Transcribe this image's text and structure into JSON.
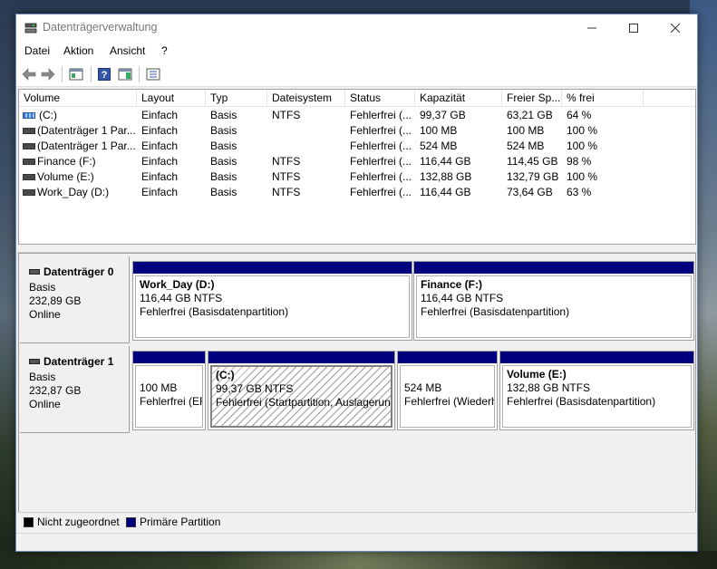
{
  "window": {
    "title": "Datenträgerverwaltung"
  },
  "menu": [
    "Datei",
    "Aktion",
    "Ansicht",
    "?"
  ],
  "list": {
    "columns": [
      "Volume",
      "Layout",
      "Typ",
      "Dateisystem",
      "Status",
      "Kapazität",
      "Freier Sp...",
      "% frei"
    ],
    "rows": [
      {
        "volume": "(C:)",
        "layout": "Einfach",
        "type": "Basis",
        "fs": "NTFS",
        "status": "Fehlerfrei (...",
        "capacity": "99,37 GB",
        "free": "63,21 GB",
        "pct": "64 %"
      },
      {
        "volume": "(Datenträger 1 Par...",
        "layout": "Einfach",
        "type": "Basis",
        "fs": "",
        "status": "Fehlerfrei (...",
        "capacity": "100 MB",
        "free": "100 MB",
        "pct": "100 %"
      },
      {
        "volume": "(Datenträger 1 Par...",
        "layout": "Einfach",
        "type": "Basis",
        "fs": "",
        "status": "Fehlerfrei (...",
        "capacity": "524 MB",
        "free": "524 MB",
        "pct": "100 %"
      },
      {
        "volume": "Finance (F:)",
        "layout": "Einfach",
        "type": "Basis",
        "fs": "NTFS",
        "status": "Fehlerfrei (...",
        "capacity": "116,44 GB",
        "free": "114,45 GB",
        "pct": "98 %"
      },
      {
        "volume": "Volume (E:)",
        "layout": "Einfach",
        "type": "Basis",
        "fs": "NTFS",
        "status": "Fehlerfrei (...",
        "capacity": "132,88 GB",
        "free": "132,79 GB",
        "pct": "100 %"
      },
      {
        "volume": "Work_Day (D:)",
        "layout": "Einfach",
        "type": "Basis",
        "fs": "NTFS",
        "status": "Fehlerfrei (...",
        "capacity": "116,44 GB",
        "free": "73,64 GB",
        "pct": "63 %"
      }
    ]
  },
  "disks": [
    {
      "name": "Datenträger 0",
      "type": "Basis",
      "size": "232,89 GB",
      "state": "Online",
      "partitions": [
        {
          "name": "Work_Day  (D:)",
          "size": "116,44 GB NTFS",
          "status": "Fehlerfrei (Basisdatenpartition)"
        },
        {
          "name": "Finance  (F:)",
          "size": "116,44 GB NTFS",
          "status": "Fehlerfrei (Basisdatenpartition)"
        }
      ]
    },
    {
      "name": "Datenträger 1",
      "type": "Basis",
      "size": "232,87 GB",
      "state": "Online",
      "partitions": [
        {
          "name": "",
          "size": "100 MB",
          "status": "Fehlerfrei (EF"
        },
        {
          "name": "(C:)",
          "size": "99,37 GB NTFS",
          "status": "Fehlerfrei (Startpartition, Auslagerun"
        },
        {
          "name": "",
          "size": "524 MB",
          "status": "Fehlerfrei (Wiederh"
        },
        {
          "name": "Volume  (E:)",
          "size": "132,88 GB NTFS",
          "status": "Fehlerfrei (Basisdatenpartition)"
        }
      ]
    }
  ],
  "legend": [
    {
      "label": "Nicht zugeordnet",
      "color": "#000000"
    },
    {
      "label": "Primäre Partition",
      "color": "#00007f"
    }
  ]
}
